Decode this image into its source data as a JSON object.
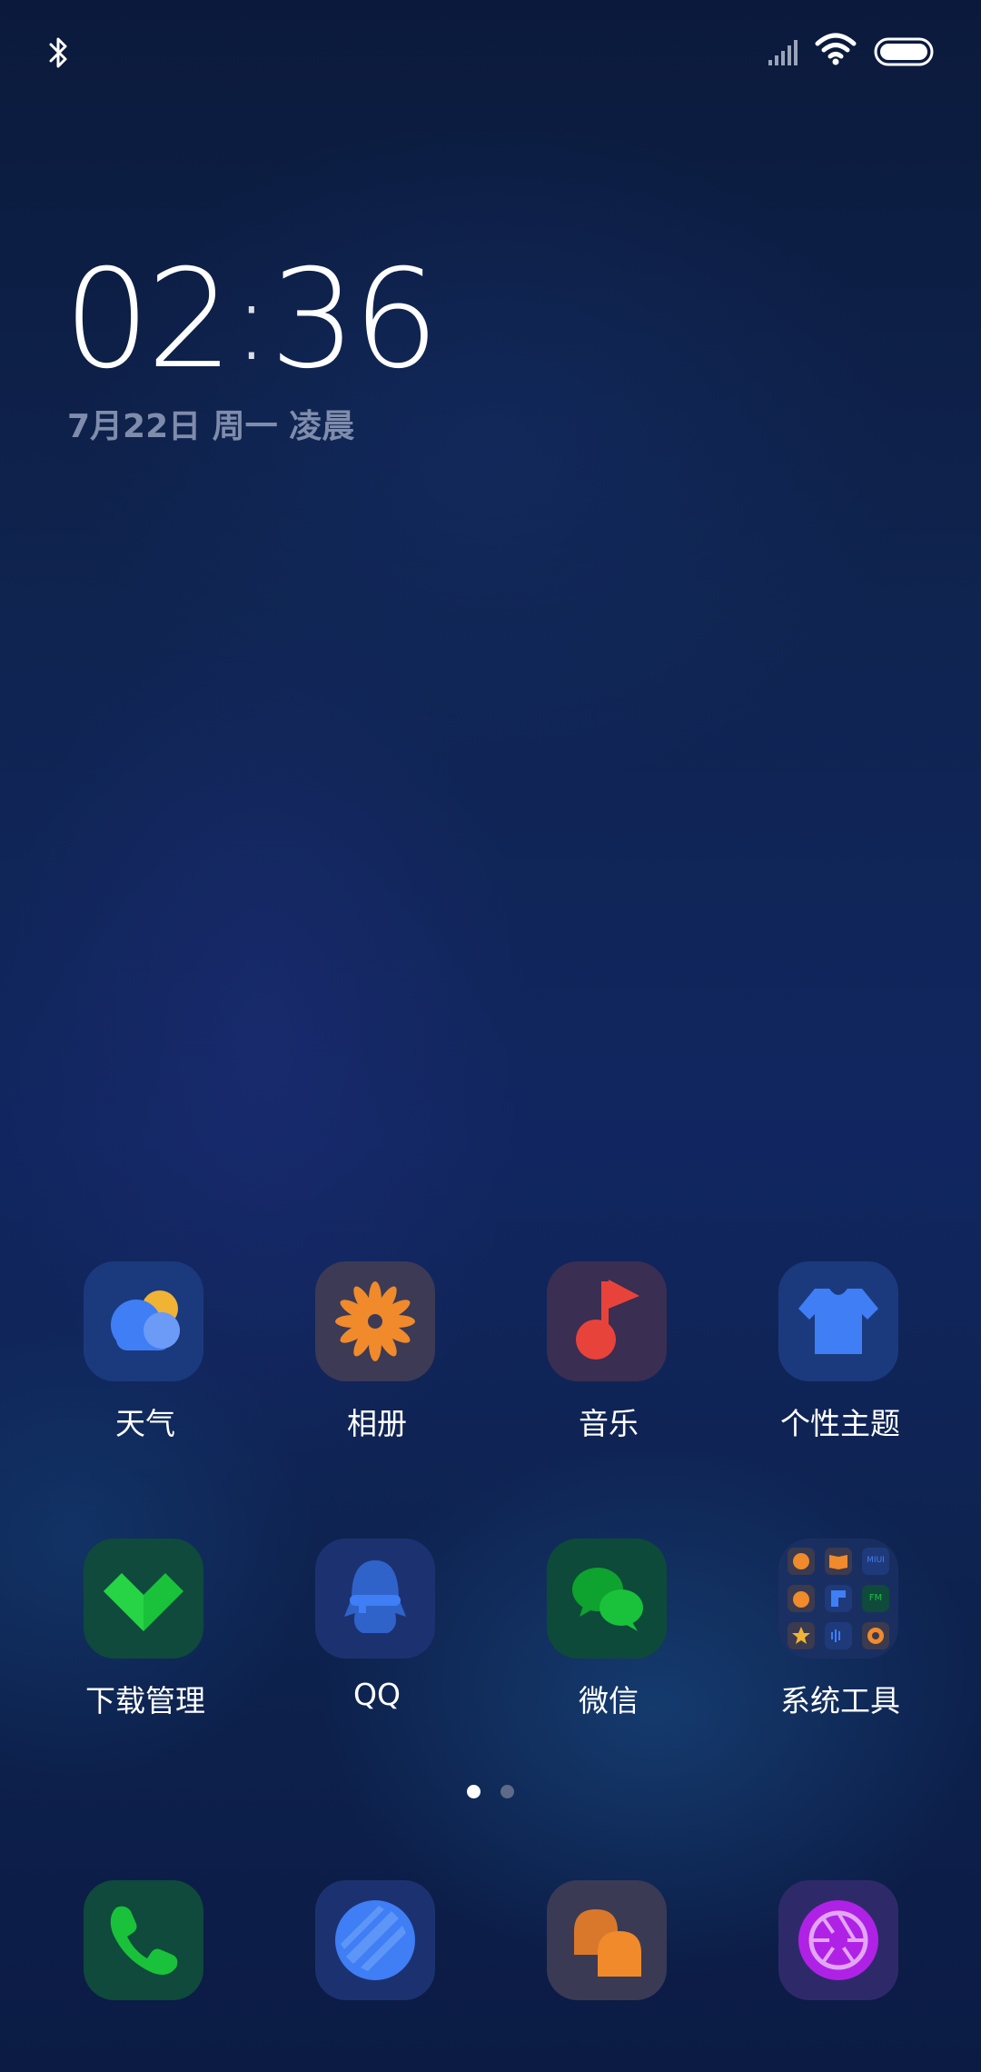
{
  "status_bar": {
    "bluetooth": "bluetooth-icon",
    "signal": "signal-icon",
    "wifi": "wifi-icon",
    "battery": "battery-icon"
  },
  "clock": {
    "hours": "02",
    "separator": ":",
    "minutes": "36",
    "date": "7月22日 周一 凌晨"
  },
  "apps": [
    {
      "label": "天气",
      "icon": "weather-icon"
    },
    {
      "label": "相册",
      "icon": "gallery-icon"
    },
    {
      "label": "音乐",
      "icon": "music-icon"
    },
    {
      "label": "个性主题",
      "icon": "themes-icon"
    },
    {
      "label": "下载管理",
      "icon": "downloads-icon"
    },
    {
      "label": "QQ",
      "icon": "qq-icon"
    },
    {
      "label": "微信",
      "icon": "wechat-icon"
    },
    {
      "label": "系统工具",
      "icon": "system-tools-folder-icon"
    }
  ],
  "system_tools_folder": {
    "mini_labels": [
      "MIUI",
      "FM"
    ]
  },
  "page_indicator": {
    "current": 1,
    "total": 2
  },
  "dock": [
    {
      "icon": "phone-icon"
    },
    {
      "icon": "browser-icon"
    },
    {
      "icon": "messages-icon"
    },
    {
      "icon": "camera-icon"
    }
  ],
  "colors": {
    "accent_blue": "#3f7ef5",
    "accent_orange": "#f08a2b",
    "accent_red": "#e8433a",
    "accent_green": "#19c23a",
    "accent_purple": "#b021e6",
    "date_text": "#7f8cab"
  }
}
